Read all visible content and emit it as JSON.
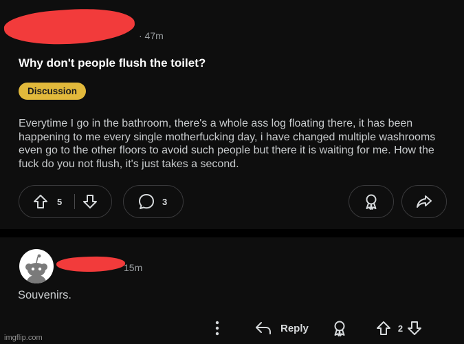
{
  "post": {
    "time": "· 47m",
    "title": "Why don't people flush the toilet?",
    "flair": "Discussion",
    "body": "Everytime I go in the bathroom, there's a whole ass log floating there, it has been happening to me every single motherfucking day, i have changed multiple washrooms even go to the other floors to avoid such people but there it is waiting for me. How the fuck do you not flush, it's just takes a second.",
    "vote_count": "5",
    "comment_count": "3",
    "colors": {
      "flair_bg": "#e2b93b",
      "redaction": "#f23b3b"
    }
  },
  "comment": {
    "time": "15m",
    "text": "Souvenirs.",
    "reply_label": "Reply",
    "vote_count": "2"
  },
  "watermark": "imgflip.com",
  "icons": [
    "upvote-icon",
    "downvote-icon",
    "comment-bubble-icon",
    "award-icon",
    "share-icon",
    "more-dots-icon",
    "reply-arrow-icon",
    "snoo-avatar-icon"
  ]
}
